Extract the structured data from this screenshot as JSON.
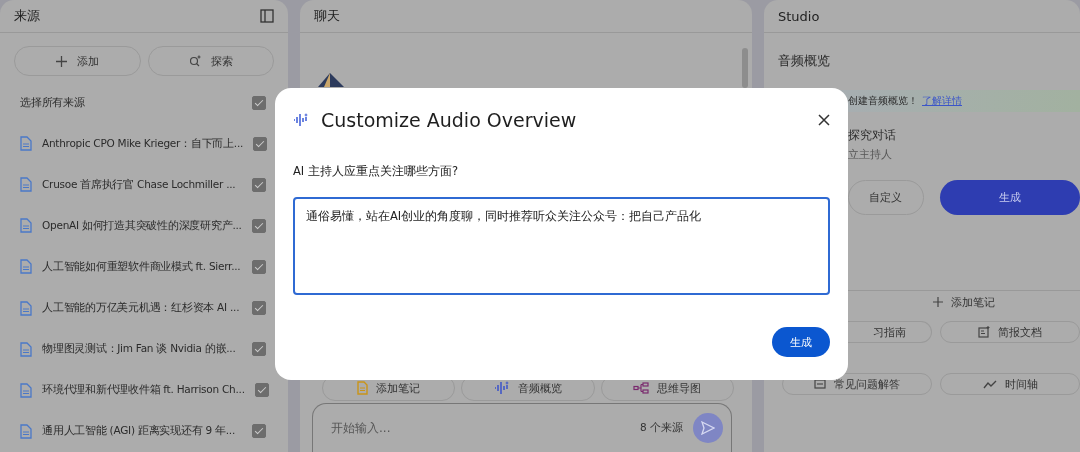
{
  "sources_panel": {
    "title": "来源",
    "buttons": [
      {
        "label": "添加",
        "kind": "add"
      },
      {
        "label": "探索",
        "kind": "discover"
      }
    ],
    "select_all": {
      "label": "选择所有来源",
      "checked": true
    },
    "items": [
      {
        "title": "Anthropic CPO Mike Krieger：自下而上...",
        "checked": true
      },
      {
        "title": "Crusoe 首席执行官 Chase Lochmiller ...",
        "checked": true
      },
      {
        "title": "OpenAI 如何打造其突破性的深度研究产...",
        "checked": true
      },
      {
        "title": "人工智能如何重塑软件商业模式 ft. Sierr...",
        "checked": true
      },
      {
        "title": "人工智能的万亿美元机遇：红杉资本 AI ...",
        "checked": true
      },
      {
        "title": "物理图灵测试：Jim Fan 谈 Nvidia 的嵌...",
        "checked": true
      },
      {
        "title": "环境代理和新代理收件箱 ft. Harrison Ch...",
        "checked": true
      },
      {
        "title": "通用人工智能 (AGI) 距离实现还有 9 年...",
        "checked": true
      }
    ]
  },
  "chat_panel": {
    "title": "聊天",
    "chips": [
      {
        "label": "添加笔记",
        "kind": "note"
      },
      {
        "label": "音频概览",
        "kind": "audio"
      },
      {
        "label": "思维导图",
        "kind": "mindmap"
      }
    ],
    "input": {
      "placeholder": "开始输入...",
      "source_count": "8 个来源"
    }
  },
  "studio_panel": {
    "title": "Studio",
    "section": "音频概览",
    "banner": {
      "text": "创建音频概览！",
      "link": "了解详情"
    },
    "format": {
      "title": "探究对话",
      "subtitle": "立主持人"
    },
    "buttons": [
      {
        "label": "自定义",
        "kind": "outline"
      },
      {
        "label": "生成",
        "kind": "primary"
      }
    ],
    "add_note": "添加笔记",
    "tools": [
      {
        "label": "习指南",
        "kind": "guide"
      },
      {
        "label": "简报文档",
        "kind": "brief"
      },
      {
        "label": "常见问题解答",
        "kind": "faq"
      },
      {
        "label": "时间轴",
        "kind": "timeline"
      }
    ]
  },
  "dialog": {
    "title": "Customize Audio Overview",
    "question": "AI 主持人应重点关注哪些方面?",
    "answer": "通俗易懂，站在AI创业的角度聊，同时推荐听众关注公众号：把自己产品化",
    "button": "生成"
  }
}
